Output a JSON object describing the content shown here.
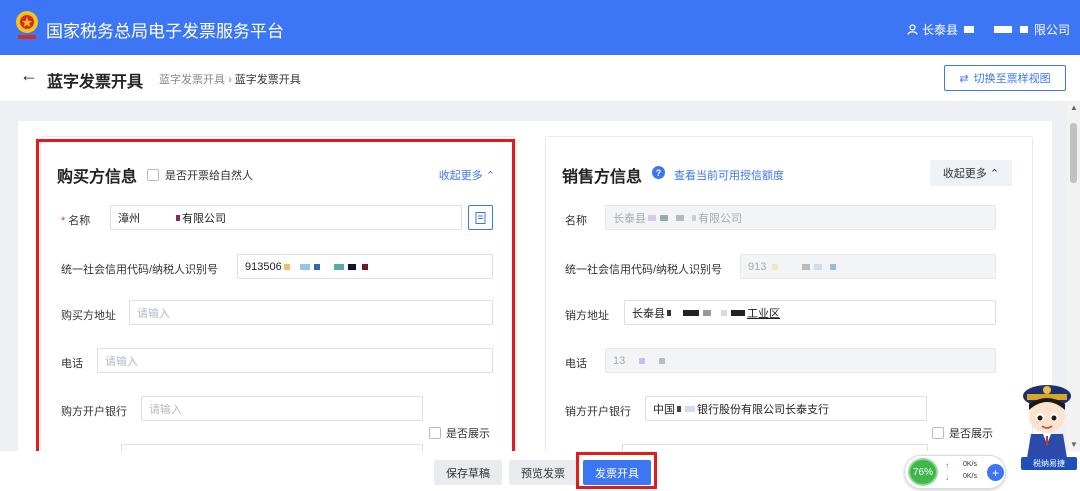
{
  "app": {
    "title": "国家税务总局电子发票服务平台",
    "user_prefix": "长泰县",
    "user_suffix": "限公司"
  },
  "header": {
    "page_title": "蓝字发票开具",
    "breadcrumb": [
      "蓝字发票开具",
      "蓝字发票开具"
    ],
    "switch_label": "切换至票样视图"
  },
  "buyer": {
    "title": "购买方信息",
    "natural_person_label": "是否开票给自然人",
    "collapse_label": "收起更多",
    "name_label": "名称",
    "name_value_prefix": "漳州",
    "name_value_suffix": "有限公司",
    "taxid_label": "统一社会信用代码/纳税人识别号",
    "taxid_value": "913506",
    "address_label": "购买方地址",
    "address_placeholder": "请输入",
    "phone_label": "电话",
    "phone_placeholder": "请输入",
    "bank_label": "购方开户银行",
    "bank_placeholder": "请输入",
    "show_label": "是否展示"
  },
  "seller": {
    "title": "销售方信息",
    "quota_link": "查看当前可用授信额度",
    "collapse_label": "收起更多",
    "name_label": "名称",
    "name_value_prefix": "长泰县",
    "name_value_suffix": "有限公司",
    "taxid_label": "统一社会信用代码/纳税人识别号",
    "taxid_value": "913",
    "address_label": "销方地址",
    "address_value_prefix": "长泰县",
    "address_value_suffix": "工业区",
    "phone_label": "电话",
    "phone_value": "13",
    "bank_label": "销方开户银行",
    "bank_value_prefix": "中国",
    "bank_value_suffix": "银行股份有限公司长泰支行",
    "show_label": "是否展示"
  },
  "footer": {
    "save_draft": "保存草稿",
    "preview": "预览发票",
    "issue": "发票开具"
  },
  "network": {
    "percent": "76%",
    "upload": "0K/s",
    "download": "0K/s"
  },
  "mascot": {
    "label": "税纳易捷"
  },
  "colors": {
    "primary": "#3d76f5",
    "highlight": "#e41b1b"
  }
}
